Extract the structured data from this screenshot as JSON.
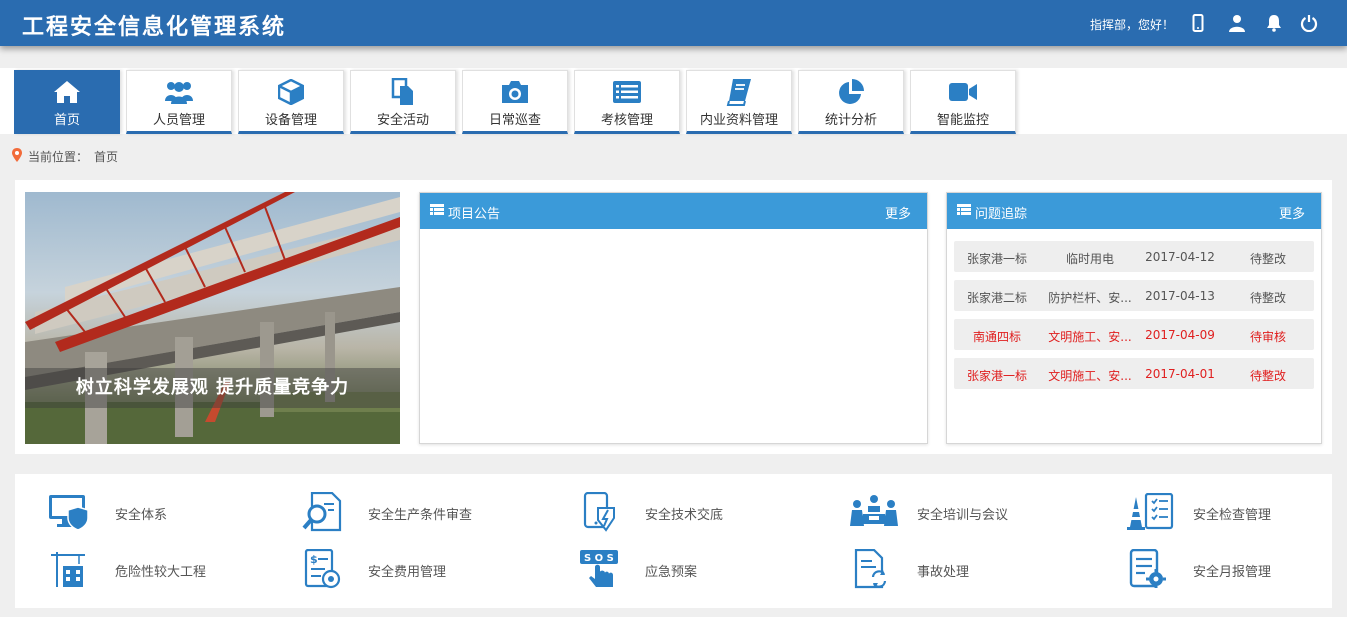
{
  "header": {
    "title": "工程安全信息化管理系统",
    "greeting": "指挥部，您好！",
    "icons": [
      "mobile-icon",
      "user-icon",
      "bell-icon",
      "power-icon"
    ]
  },
  "nav": {
    "tabs": [
      {
        "label": "首页",
        "icon": "home-icon",
        "active": true
      },
      {
        "label": "人员管理",
        "icon": "users-icon"
      },
      {
        "label": "设备管理",
        "icon": "cube-icon"
      },
      {
        "label": "安全活动",
        "icon": "documents-icon"
      },
      {
        "label": "日常巡查",
        "icon": "camera-icon"
      },
      {
        "label": "考核管理",
        "icon": "list-icon"
      },
      {
        "label": "内业资料管理",
        "icon": "book-icon"
      },
      {
        "label": "统计分析",
        "icon": "pie-chart-icon"
      },
      {
        "label": "智能监控",
        "icon": "video-camera-icon"
      }
    ]
  },
  "breadcrumb": {
    "prefix": "当前位置：",
    "current": "首页"
  },
  "banner": {
    "caption": "树立科学发展观 提升质量竞争力"
  },
  "notices": {
    "title": "项目公告",
    "more": "更多",
    "items": []
  },
  "issues": {
    "title": "问题追踪",
    "more": "更多",
    "rows": [
      {
        "section": "张家港一标",
        "topic": "临时用电",
        "date": "2017-04-12",
        "status": "待整改",
        "highlight": false
      },
      {
        "section": "张家港二标",
        "topic": "防护栏杆、安...",
        "date": "2017-04-13",
        "status": "待整改",
        "highlight": false
      },
      {
        "section": "南通四标",
        "topic": "文明施工、安...",
        "date": "2017-04-09",
        "status": "待审核",
        "highlight": true
      },
      {
        "section": "张家港一标",
        "topic": "文明施工、安...",
        "date": "2017-04-01",
        "status": "待整改",
        "highlight": true
      }
    ]
  },
  "quick_links": [
    {
      "label": "安全体系",
      "icon": "monitor-shield-icon"
    },
    {
      "label": "安全生产条件审查",
      "icon": "document-search-icon"
    },
    {
      "label": "安全技术交底",
      "icon": "tablet-lightning-icon"
    },
    {
      "label": "安全培训与会议",
      "icon": "meeting-icon"
    },
    {
      "label": "安全检查管理",
      "icon": "cone-checklist-icon"
    },
    {
      "label": "危险性较大工程",
      "icon": "crane-building-icon"
    },
    {
      "label": "安全费用管理",
      "icon": "cost-document-icon"
    },
    {
      "label": "应急预案",
      "icon": "sos-hand-icon"
    },
    {
      "label": "事故处理",
      "icon": "document-refresh-icon"
    },
    {
      "label": "安全月报管理",
      "icon": "report-gear-icon"
    }
  ],
  "colors": {
    "header": "#2a6cb0",
    "box_header": "#3b9ad9",
    "alert_red": "#e02020",
    "icon_blue": "#2b7fc4"
  }
}
